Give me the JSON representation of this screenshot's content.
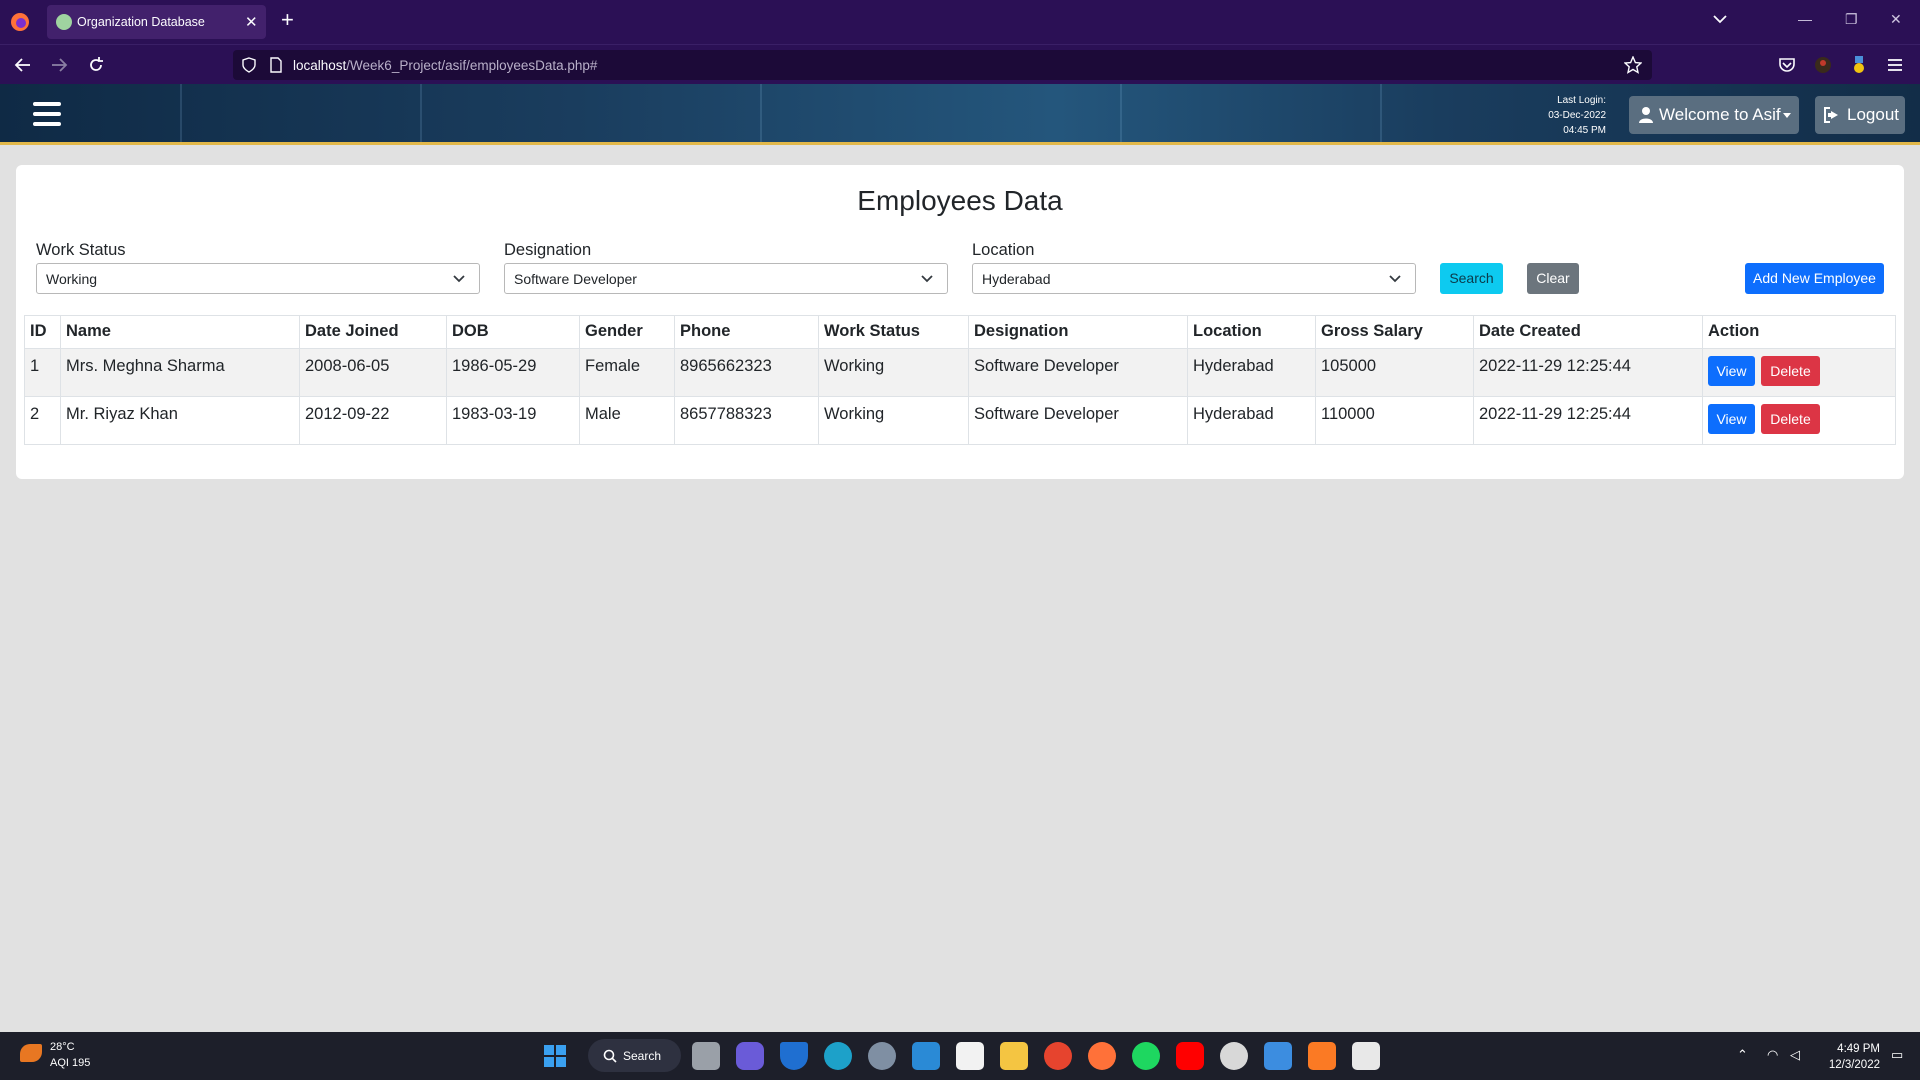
{
  "browser": {
    "tab_title": "Organization Database",
    "url_host": "localhost",
    "url_path": "/Week6_Project/asif/employeesData.php#"
  },
  "header": {
    "last_login_label": "Last Login:",
    "last_login_date": "03-Dec-2022",
    "last_login_time": "04:45 PM",
    "welcome_label": "Welcome to Asif",
    "logout_label": "Logout"
  },
  "page": {
    "title": "Employees Data"
  },
  "filters": {
    "work_status": {
      "label": "Work Status",
      "value": "Working"
    },
    "designation": {
      "label": "Designation",
      "value": "Software Developer"
    },
    "location": {
      "label": "Location",
      "value": "Hyderabad"
    },
    "search_label": "Search",
    "clear_label": "Clear",
    "add_label": "Add New Employee"
  },
  "table": {
    "headers": [
      "ID",
      "Name",
      "Date Joined",
      "DOB",
      "Gender",
      "Phone",
      "Work Status",
      "Designation",
      "Location",
      "Gross Salary",
      "Date Created",
      "Action"
    ],
    "rows": [
      {
        "id": "1",
        "name": "Mrs. Meghna Sharma",
        "date_joined": "2008-06-05",
        "dob": "1986-05-29",
        "gender": "Female",
        "phone": "8965662323",
        "work_status": "Working",
        "designation": "Software Developer",
        "location": "Hyderabad",
        "gross_salary": "105000",
        "date_created": "2022-11-29 12:25:44"
      },
      {
        "id": "2",
        "name": "Mr. Riyaz Khan",
        "date_joined": "2012-09-22",
        "dob": "1983-03-19",
        "gender": "Male",
        "phone": "8657788323",
        "work_status": "Working",
        "designation": "Software Developer",
        "location": "Hyderabad",
        "gross_salary": "110000",
        "date_created": "2022-11-29 12:25:44"
      }
    ],
    "view_label": "View",
    "delete_label": "Delete"
  },
  "taskbar": {
    "temperature": "28°C",
    "aqi": "AQI 195",
    "search_label": "Search",
    "time": "4:49 PM",
    "date": "12/3/2022"
  },
  "colors": {
    "browser_bg": "#2b1055",
    "search_btn": "#0dcaf0",
    "clear_btn": "#6c757d",
    "primary": "#0d6efd",
    "danger": "#dc3545"
  }
}
